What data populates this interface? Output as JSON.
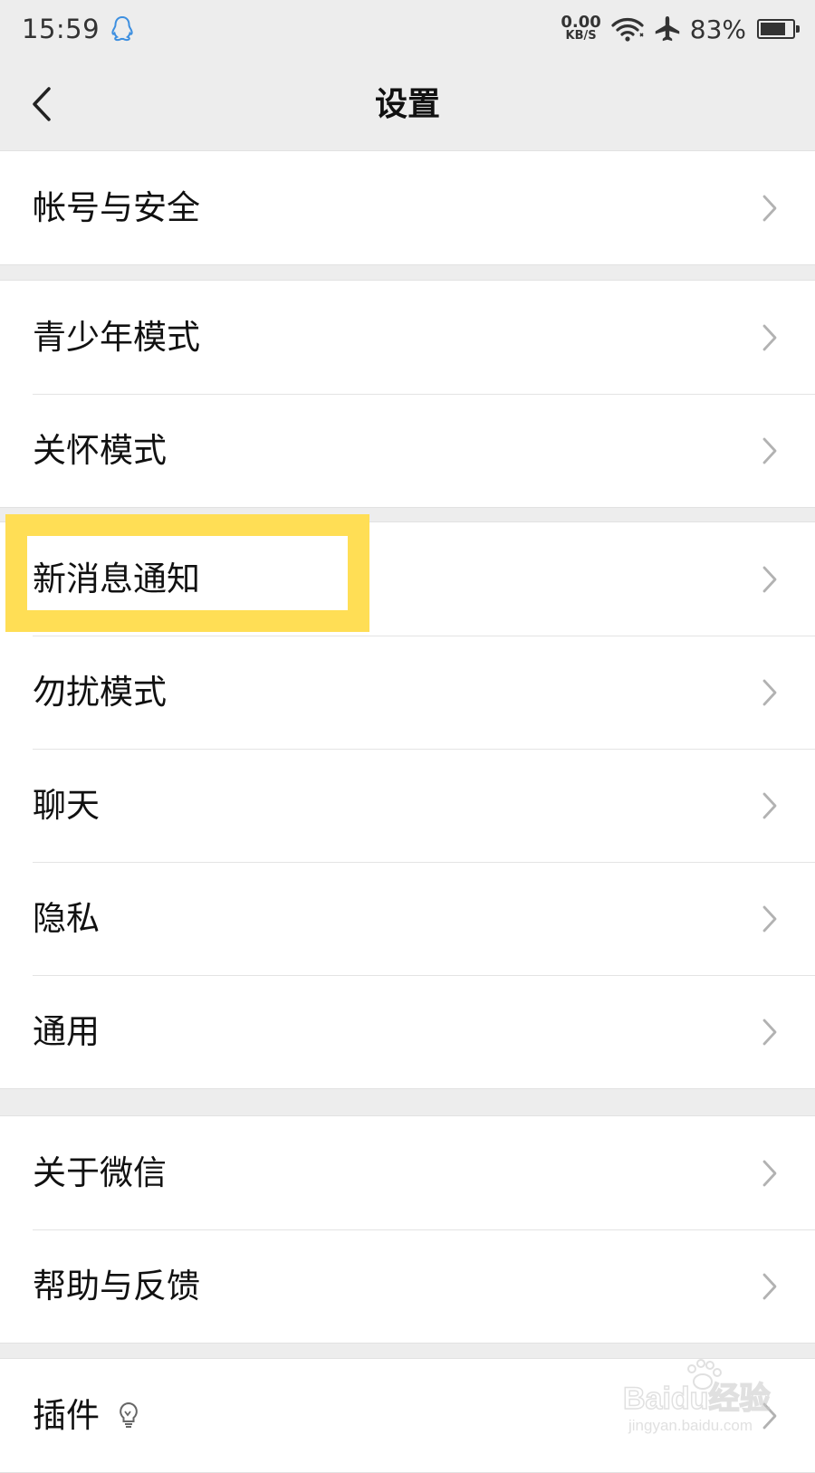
{
  "status_bar": {
    "time": "15:59",
    "net_speed_value": "0.00",
    "net_speed_unit": "KB/S",
    "battery_percent": "83%",
    "battery_level": 0.83,
    "icons": [
      "qq-icon",
      "wifi-icon",
      "airplane-mode-icon",
      "battery-icon"
    ]
  },
  "nav": {
    "title": "设置",
    "back_icon": "chevron-left-icon"
  },
  "sections": [
    {
      "items": [
        {
          "label": "帐号与安全"
        }
      ]
    },
    {
      "items": [
        {
          "label": "青少年模式"
        },
        {
          "label": "关怀模式"
        }
      ]
    },
    {
      "items": [
        {
          "label": "新消息通知"
        },
        {
          "label": "勿扰模式"
        },
        {
          "label": "聊天"
        },
        {
          "label": "隐私"
        },
        {
          "label": "通用"
        }
      ]
    },
    {
      "items": [
        {
          "label": "关于微信"
        },
        {
          "label": "帮助与反馈"
        }
      ]
    },
    {
      "items": [
        {
          "label": "插件",
          "icon": "bulb-icon"
        }
      ]
    }
  ],
  "highlight": {
    "target": "新消息通知",
    "color": "#ffde55"
  },
  "watermark": {
    "text": "Baidu经验",
    "subtext": "jingyan.baidu.com"
  },
  "colors": {
    "background": "#ededed",
    "row_background": "#ffffff",
    "chevron": "#b2b2b2"
  }
}
